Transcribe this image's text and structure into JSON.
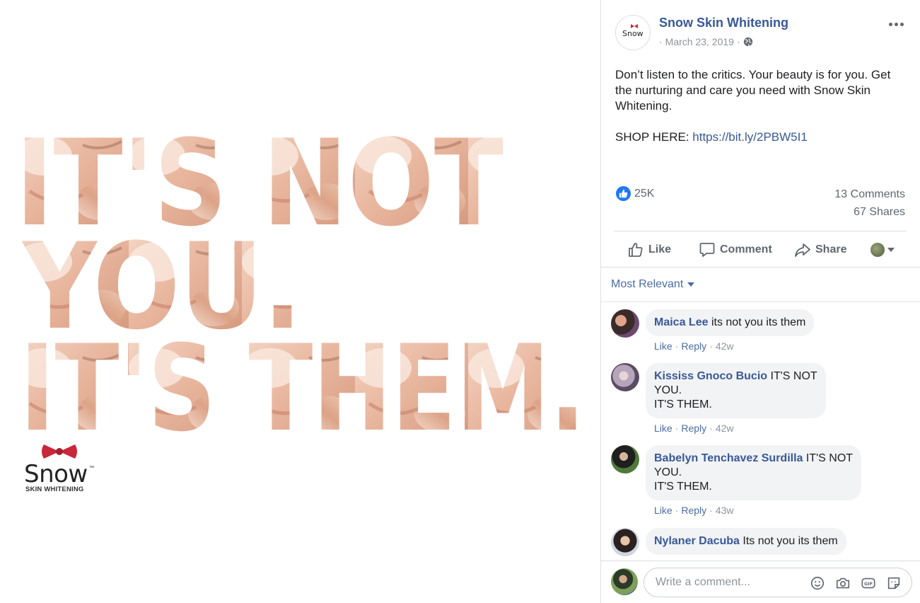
{
  "photo": {
    "ad_text_lines": [
      "IT'S NOT",
      "YOU.",
      "IT'S THEM."
    ],
    "brand_logo": {
      "word": "Snow",
      "tm": "™",
      "subtitle": "SKIN WHITENING"
    }
  },
  "post": {
    "page_name": "Snow Skin Whitening",
    "avatar_text": "Snow",
    "date": "March 23, 2019",
    "separator": "·",
    "audience_icon": "globe-icon",
    "text_lines": [
      "Don’t listen to the critics. Your beauty is for you. Get",
      "the nurturing and care you need with Snow Skin",
      "Whitening."
    ],
    "shop_label": "SHOP HERE: ",
    "shop_link": "https://bit.ly/2PBW5I1"
  },
  "stats": {
    "reactions": "25K",
    "comments": "13 Comments",
    "shares": "67 Shares"
  },
  "actions": {
    "like": "Like",
    "comment": "Comment",
    "share": "Share"
  },
  "comments_section": {
    "sort_label": "Most Relevant",
    "items": [
      {
        "author": "Maica Lee",
        "text_lines": [
          "its not you its them"
        ],
        "like": "Like",
        "reply": "Reply",
        "time": "42w"
      },
      {
        "author": "Kississ Gnoco Bucio",
        "text_lines": [
          "IT'S NOT",
          "YOU.",
          "IT'S THEM."
        ],
        "like": "Like",
        "reply": "Reply",
        "time": "42w"
      },
      {
        "author": "Babelyn Tenchavez Surdilla",
        "text_lines": [
          "IT'S NOT",
          "YOU.",
          "IT'S THEM."
        ],
        "like": "Like",
        "reply": "Reply",
        "time": "43w"
      },
      {
        "author": "Nylaner Dacuba",
        "text_lines": [
          "Its not you its them"
        ]
      }
    ],
    "composer_placeholder": "Write a comment..."
  },
  "colors": {
    "link": "#385898",
    "like_blue": "#2078f4",
    "muted": "#606770"
  }
}
